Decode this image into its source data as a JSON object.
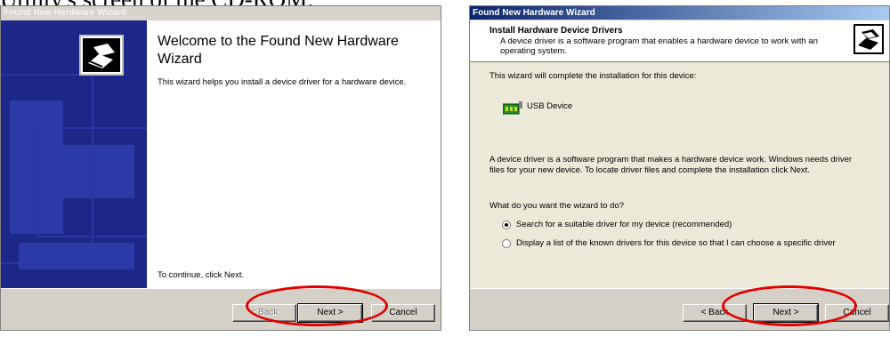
{
  "document": {
    "top_text": "Utility's screen of the CD-ROM."
  },
  "wizard_welcome": {
    "title": "Found New Hardware Wizard",
    "heading": "Welcome to the Found New Hardware Wizard",
    "description": "This wizard helps you install a device driver for a hardware device.",
    "continue_text": "To continue, click Next.",
    "back_label": "< Back",
    "next_label": "Next >",
    "cancel_label": "Cancel"
  },
  "wizard_install": {
    "title": "Found New Hardware Wizard",
    "header_title": "Install Hardware Device Drivers",
    "header_subtitle": "A device driver is a software program that enables a hardware device to work with an operating system.",
    "intro": "This wizard will complete the installation for this device:",
    "device_name": "USB Device",
    "driver_text": "A device driver is a software program that makes a hardware device work. Windows needs driver files for your new device. To locate driver files and complete the installation click Next.",
    "question": "What do you want the wizard to do?",
    "options": [
      {
        "label": "Search for a suitable driver for my device (recommended)",
        "selected": true
      },
      {
        "label": "Display a list of the known drivers for this device so that I can choose a specific driver",
        "selected": false
      }
    ],
    "back_label": "< Back",
    "next_label": "Next >",
    "cancel_label": "Cancel"
  },
  "colors": {
    "highlight_ellipse": "#e00000",
    "title_bar_active": "#0a246a",
    "side_panel": "#1d2787"
  }
}
